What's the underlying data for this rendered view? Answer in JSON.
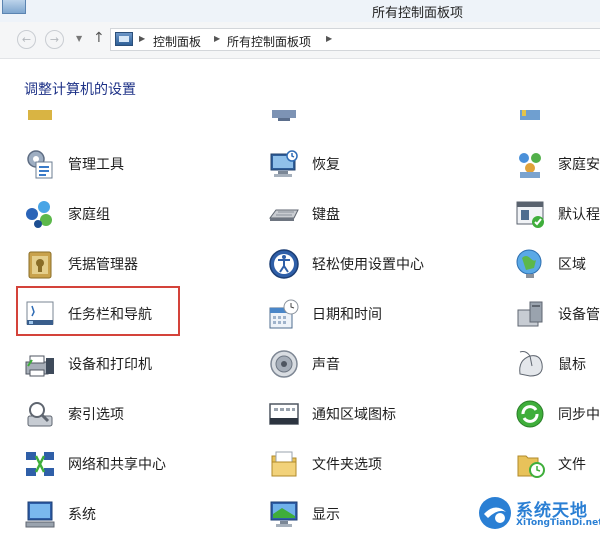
{
  "window": {
    "title": "所有控制面板项"
  },
  "breadcrumb": {
    "items": [
      "控制面板",
      "所有控制面板项"
    ]
  },
  "header": {
    "title": "调整计算机的设置"
  },
  "items": [
    {
      "label": "管理工具",
      "icon": "admin-tools-icon"
    },
    {
      "label": "恢复",
      "icon": "recovery-icon"
    },
    {
      "label": "家庭安",
      "icon": "family-safety-icon"
    },
    {
      "label": "家庭组",
      "icon": "homegroup-icon"
    },
    {
      "label": "键盘",
      "icon": "keyboard-icon"
    },
    {
      "label": "默认程",
      "icon": "default-programs-icon"
    },
    {
      "label": "凭据管理器",
      "icon": "credential-manager-icon"
    },
    {
      "label": "轻松使用设置中心",
      "icon": "ease-of-access-icon"
    },
    {
      "label": "区域",
      "icon": "region-icon"
    },
    {
      "label": "任务栏和导航",
      "icon": "taskbar-icon"
    },
    {
      "label": "日期和时间",
      "icon": "date-time-icon"
    },
    {
      "label": "设备管",
      "icon": "device-manager-icon"
    },
    {
      "label": "设备和打印机",
      "icon": "devices-printers-icon"
    },
    {
      "label": "声音",
      "icon": "sound-icon"
    },
    {
      "label": "鼠标",
      "icon": "mouse-icon"
    },
    {
      "label": "索引选项",
      "icon": "indexing-icon"
    },
    {
      "label": "通知区域图标",
      "icon": "notification-icons-icon"
    },
    {
      "label": "同步中",
      "icon": "sync-center-icon"
    },
    {
      "label": "网络和共享中心",
      "icon": "network-icon"
    },
    {
      "label": "文件夹选项",
      "icon": "folder-options-icon"
    },
    {
      "label": "文件",
      "icon": "file-history-icon"
    },
    {
      "label": "系统",
      "icon": "system-icon"
    },
    {
      "label": "显示",
      "icon": "display-icon"
    }
  ],
  "watermark": {
    "name": "系统天地",
    "url": "XiTongTianDi.net"
  },
  "colors": {
    "header_title": "#1e3287",
    "highlight": "#d4433a",
    "watermark": "#2a7fd4"
  }
}
